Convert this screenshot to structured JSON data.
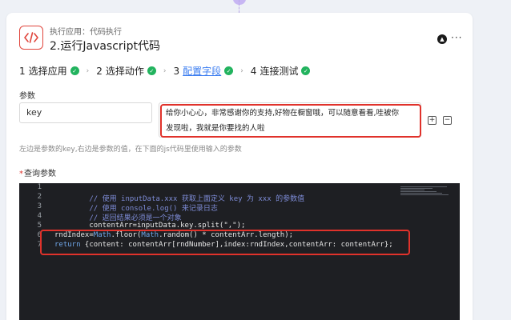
{
  "node": {
    "app_sub": "执行应用：代码执行",
    "title": "2.运行Javascript代码"
  },
  "steps": [
    {
      "num": "1",
      "label": "选择应用",
      "done": true
    },
    {
      "num": "2",
      "label": "选择动作",
      "done": true
    },
    {
      "num": "3",
      "label": "配置字段",
      "done": true,
      "active": true
    },
    {
      "num": "4",
      "label": "连接测试",
      "done": true
    }
  ],
  "params": {
    "label": "参数",
    "key_value": "key",
    "value_line1": "给你小心心，非常感谢你的支持,好物在橱窗哦，可以随意看看,哇被你",
    "value_line2": "发现啦，我就是你要找的人啦",
    "hint": "左边是参数的key,右边是参数的值，在下面的js代码里使用输入的参数"
  },
  "query": {
    "required_mark": "*",
    "label": "查询参数"
  },
  "code": {
    "line_numbers": [
      "1",
      "2",
      "3",
      "4",
      "5",
      "6",
      "7"
    ],
    "line2": "        // 使用 inputData.xxx 获取上面定义 key 为 xxx 的参数值",
    "line3": "        // 使用 console.log() 来记录日志",
    "line4": "        // 返回结果必须是一个对象",
    "line5": "        contentArr=inputData.key.split(\",\");",
    "line6_a": "rndIndex=",
    "line6_kw1": "Math",
    "line6_b": ".floor(",
    "line6_kw2": "Math",
    "line6_c": ".random() * contentArr.length);",
    "line7_kw": "return",
    "line7_rest": " {content: contentArr[rndNumber],index:rndIndex,contentArr: contentArr};"
  },
  "colors": {
    "accent": "#3a7cf0",
    "success": "#22b35e",
    "highlight": "#e0322b",
    "editor_bg": "#1e1f23"
  },
  "icons": {
    "app": "code-brackets-icon",
    "collapse": "chevron-up-icon",
    "more": "more-icon",
    "check": "check-circle-icon",
    "step_separator": "chevron-right-icon",
    "add": "plus-square-icon",
    "remove": "minus-square-icon"
  }
}
